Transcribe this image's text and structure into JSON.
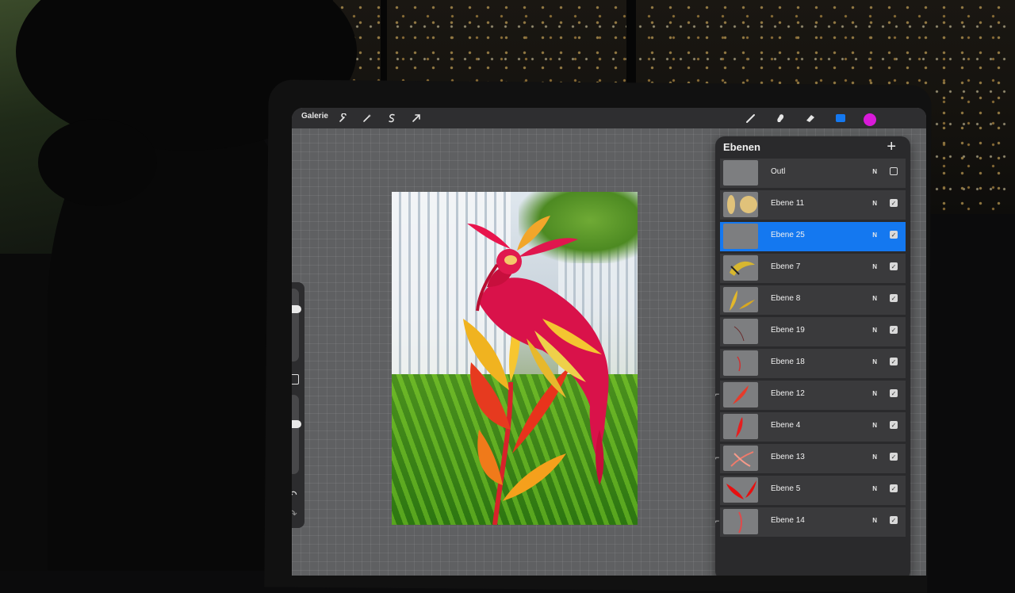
{
  "toolbar": {
    "gallery_label": "Galerie",
    "left_icons": [
      "wrench-icon",
      "magic-wand-icon",
      "selection-icon",
      "transform-arrow-icon"
    ],
    "right_icons": [
      "brush-icon",
      "smudge-icon",
      "eraser-icon",
      "layers-icon"
    ],
    "active_color": "#d91ad9",
    "layers_icon_color": "#1478f0"
  },
  "sidebar": {
    "brush_size_level": 0.25,
    "opacity_level": 0.35
  },
  "layers_panel": {
    "title": "Ebenen",
    "add_symbol": "+",
    "layers": [
      {
        "name": "Outl",
        "mode": "N",
        "visible": false,
        "selected": false,
        "clipped": false
      },
      {
        "name": "Ebene 11",
        "mode": "N",
        "visible": true,
        "selected": false,
        "clipped": false
      },
      {
        "name": "Ebene 25",
        "mode": "N",
        "visible": true,
        "selected": true,
        "clipped": false
      },
      {
        "name": "Ebene 7",
        "mode": "N",
        "visible": true,
        "selected": false,
        "clipped": false
      },
      {
        "name": "Ebene 8",
        "mode": "N",
        "visible": true,
        "selected": false,
        "clipped": false
      },
      {
        "name": "Ebene 19",
        "mode": "N",
        "visible": true,
        "selected": false,
        "clipped": false
      },
      {
        "name": "Ebene 18",
        "mode": "N",
        "visible": true,
        "selected": false,
        "clipped": false
      },
      {
        "name": "Ebene 12",
        "mode": "N",
        "visible": true,
        "selected": false,
        "clipped": true
      },
      {
        "name": "Ebene 4",
        "mode": "N",
        "visible": true,
        "selected": false,
        "clipped": false
      },
      {
        "name": "Ebene 13",
        "mode": "N",
        "visible": true,
        "selected": false,
        "clipped": true
      },
      {
        "name": "Ebene 5",
        "mode": "N",
        "visible": true,
        "selected": false,
        "clipped": false
      },
      {
        "name": "Ebene 14",
        "mode": "N",
        "visible": true,
        "selected": false,
        "clipped": true
      }
    ]
  }
}
